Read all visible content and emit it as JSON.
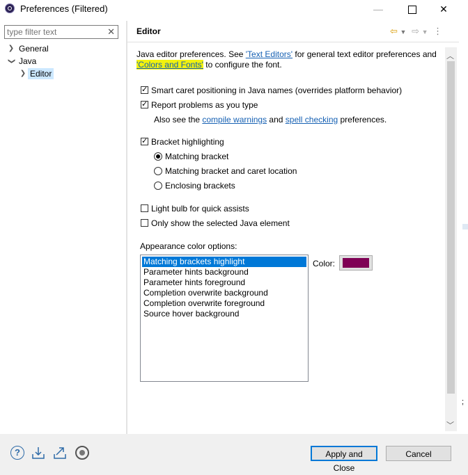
{
  "window": {
    "title": "Preferences (Filtered)"
  },
  "filter": {
    "placeholder": "type filter text"
  },
  "tree": [
    {
      "label": "General"
    },
    {
      "label": "Java"
    },
    {
      "label": "Editor"
    }
  ],
  "page": {
    "title": "Editor"
  },
  "intro": {
    "text1": "Java editor preferences. See ",
    "link1": "'Text Editors'",
    "text2": " for general text editor preferences and",
    "link2": "'Colors and Fonts'",
    "text3": " to configure the font."
  },
  "options": {
    "smart_caret": {
      "label": "Smart caret positioning in Java names (overrides platform behavior)",
      "checked": true
    },
    "report_problems": {
      "label": "Report problems as you type",
      "checked": true
    },
    "also_see": {
      "prefix": "Also see the ",
      "link1": "compile warnings",
      "middle": " and ",
      "link2": "spell checking",
      "suffix": " preferences."
    },
    "bracket_highlighting": {
      "label": "Bracket highlighting",
      "checked": true
    },
    "bracket_radios": [
      {
        "label": "Matching bracket",
        "selected": true
      },
      {
        "label": "Matching bracket and caret location",
        "selected": false
      },
      {
        "label": "Enclosing brackets",
        "selected": false
      }
    ],
    "light_bulb": {
      "label": "Light bulb for quick assists",
      "checked": false
    },
    "only_selected": {
      "label": "Only show the selected Java element",
      "checked": false
    }
  },
  "appearance": {
    "label": "Appearance color options:",
    "items": [
      "Matching brackets highlight",
      "Parameter hints background",
      "Parameter hints foreground",
      "Completion overwrite background",
      "Completion overwrite foreground",
      "Source hover background"
    ],
    "selected_index": 0,
    "color_label": "Color:",
    "color_value": "#7f0055"
  },
  "buttons": {
    "apply_close": "Apply and Close",
    "cancel": "Cancel"
  },
  "peek": {
    "char": ";"
  },
  "colors": {
    "accent": "#0078d7",
    "link": "#1560b3",
    "highlight": "#f2f20e"
  }
}
